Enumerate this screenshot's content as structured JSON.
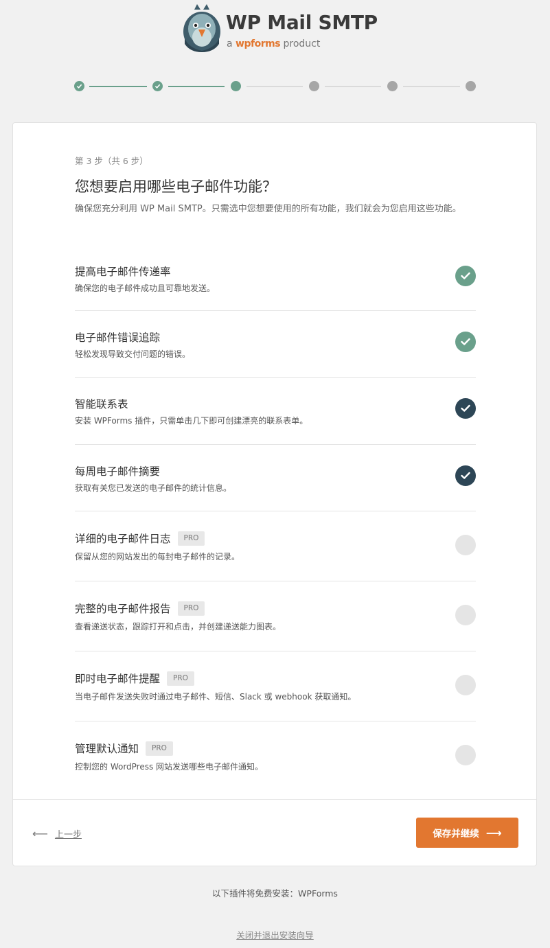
{
  "logo": {
    "title": "WP Mail SMTP",
    "sub_prefix": "a",
    "sub_brand": "wpforms",
    "sub_suffix": "product"
  },
  "steps": {
    "total": 6,
    "current": 3,
    "states": [
      "done",
      "done",
      "current",
      "todo",
      "todo",
      "todo"
    ]
  },
  "card": {
    "step_label": "第 3 步（共 6 步）",
    "heading": "您想要启用哪些电子邮件功能？",
    "intro": "确保您充分利用 WP Mail SMTP。只需选中您想要使用的所有功能，我们就会为您启用这些功能。",
    "features": [
      {
        "title": "提高电子邮件传递率",
        "desc": "确保您的电子邮件成功且可靠地发送。",
        "pro": "",
        "state": "green"
      },
      {
        "title": "电子邮件错误追踪",
        "desc": "轻松发现导致交付问题的错误。",
        "pro": "",
        "state": "green"
      },
      {
        "title": "智能联系表",
        "desc": "安装 WPForms 插件，只需单击几下即可创建漂亮的联系表单。",
        "pro": "",
        "state": "dark"
      },
      {
        "title": "每周电子邮件摘要",
        "desc": "获取有关您已发送的电子邮件的统计信息。",
        "pro": "",
        "state": "dark"
      },
      {
        "title": "详细的电子邮件日志",
        "desc": "保留从您的网站发出的每封电子邮件的记录。",
        "pro": "PRO",
        "state": "off"
      },
      {
        "title": "完整的电子邮件报告",
        "desc": "查看递送状态，跟踪打开和点击，并创建递送能力图表。",
        "pro": "PRO",
        "state": "off"
      },
      {
        "title": "即时电子邮件提醒",
        "desc": "当电子邮件发送失败时通过电子邮件、短信、Slack 或 webhook 获取通知。",
        "pro": "PRO",
        "state": "off"
      },
      {
        "title": "管理默认通知",
        "desc": "控制您的 WordPress 网站发送哪些电子邮件通知。",
        "pro": "PRO",
        "state": "off"
      }
    ],
    "back_label": "上一步",
    "back_icon": "arrow-left-icon",
    "save_label": "保存并继续",
    "save_icon": "arrow-right-icon"
  },
  "footer": {
    "note": "以下插件将免费安装：WPForms",
    "exit_link": "关闭并退出安装向导"
  },
  "colors": {
    "accent_orange": "#e27730",
    "check_green": "#6aa08b",
    "check_dark": "#2d4656"
  }
}
